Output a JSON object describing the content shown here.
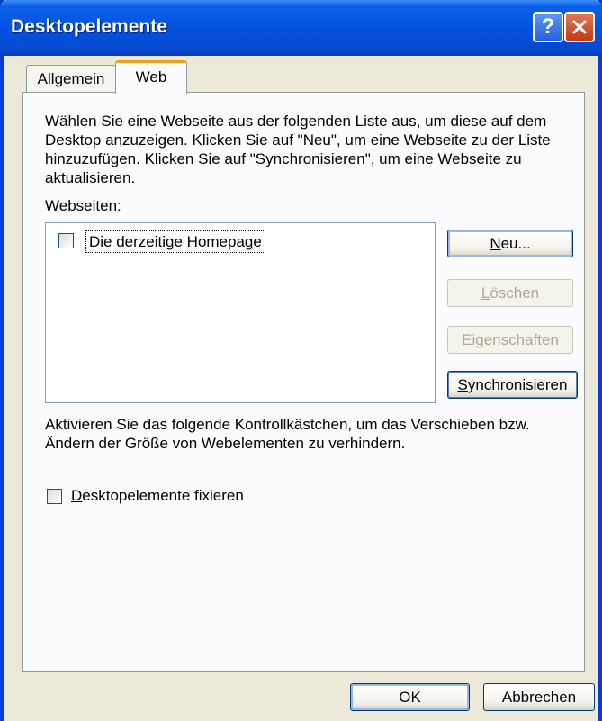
{
  "window": {
    "title": "Desktopelemente",
    "help_glyph": "?"
  },
  "tabs": [
    {
      "label": "Allgemein",
      "active": false
    },
    {
      "label": "Web",
      "active": true
    }
  ],
  "web_tab": {
    "intro": "Wählen Sie eine Webseite aus der folgenden Liste aus, um diese auf dem Desktop anzuzeigen. Klicken Sie auf \"Neu\", um eine Webseite zu der Liste hinzuzufügen. Klicken Sie auf \"Synchronisieren\", um eine Webseite zu aktualisieren.",
    "list_label_mnemonic": "W",
    "list_label_rest": "ebseiten:",
    "list_items": [
      {
        "label": "Die derzeitige Homepage",
        "checked": false
      }
    ],
    "buttons": {
      "new_mnemonic": "N",
      "new_rest": "eu...",
      "delete_mnemonic": "L",
      "delete_rest": "öschen",
      "properties_pre": "Ei",
      "properties_mnemonic": "g",
      "properties_rest": "enschaften",
      "sync_mnemonic": "S",
      "sync_rest": "ynchronisieren"
    },
    "hint": "Aktivieren Sie das folgende Kontrollkästchen, um das Verschieben bzw. Ändern der Größe von Webelementen zu verhindern.",
    "lock_mnemonic": "D",
    "lock_rest": "esktopelemente fixieren",
    "lock_checked": false
  },
  "footer": {
    "ok": "OK",
    "cancel": "Abbrechen"
  },
  "colors": {
    "titlebar": "#0552DF",
    "dialog_bg": "#ECE9D8",
    "active_tab_accent": "#F0A020"
  }
}
